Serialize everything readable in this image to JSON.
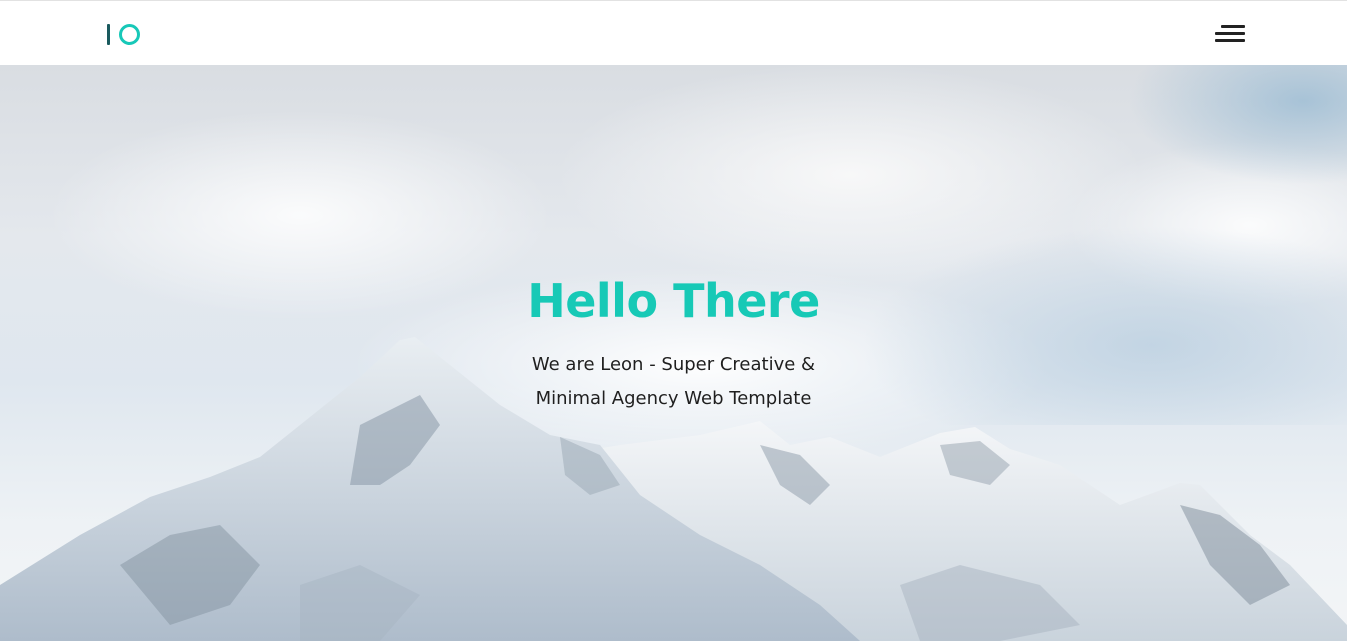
{
  "header": {
    "logo": {
      "icon": "io-logo-icon",
      "colors": {
        "bar": "#1a5a5e",
        "ring": "#17c8b8"
      }
    },
    "menu": {
      "icon": "hamburger-menu-icon"
    }
  },
  "hero": {
    "title": "Hello There",
    "subtitle_line1": "We are Leon - Super Creative &",
    "subtitle_line2": "Minimal Agency Web Template",
    "background": "snowy-mountain-cloudy-sky-image",
    "colors": {
      "accent": "#17c9b6",
      "text": "#1f1f1f"
    }
  }
}
